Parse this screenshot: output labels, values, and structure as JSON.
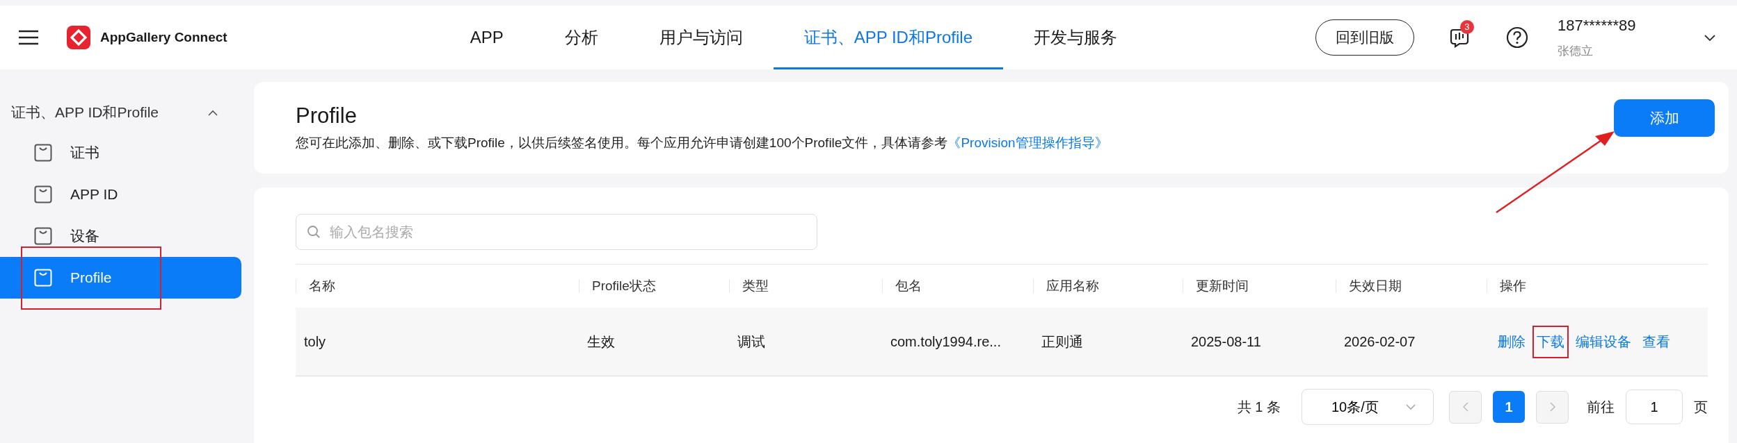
{
  "header": {
    "app_name": "AppGallery Connect",
    "nav": [
      {
        "label": "APP",
        "selected": false
      },
      {
        "label": "分析",
        "selected": false
      },
      {
        "label": "用户与访问",
        "selected": false
      },
      {
        "label": "证书、APP ID和Profile",
        "selected": true
      },
      {
        "label": "开发与服务",
        "selected": false
      }
    ],
    "old_version_button": "回到旧版",
    "notification_count": "3",
    "user": {
      "phone": "187******89",
      "name": "张德立"
    }
  },
  "sidebar": {
    "group": {
      "label": "证书、APP ID和Profile",
      "expanded": true,
      "items": [
        {
          "label": "证书",
          "selected": false,
          "highlighted": false
        },
        {
          "label": "APP ID",
          "selected": false,
          "highlighted": false
        },
        {
          "label": "设备",
          "selected": false,
          "highlighted": false
        },
        {
          "label": "Profile",
          "selected": true,
          "highlighted": true
        }
      ]
    }
  },
  "intro": {
    "title": "Profile",
    "description": "您可在此添加、删除、或下载Profile，以供后续签名使用。每个应用允许申请创建100个Profile文件，具体请参考",
    "link": "《Provision管理操作指导》",
    "add_button": "添加"
  },
  "search": {
    "placeholder": "输入包名搜索"
  },
  "table": {
    "columns": [
      "名称",
      "Profile状态",
      "类型",
      "包名",
      "应用名称",
      "更新时间",
      "失效日期",
      "操作"
    ],
    "rows": [
      {
        "cells": [
          "toly",
          "生效",
          "调试",
          "com.toly1994.re...",
          "正则通",
          "2025-08-11",
          "2026-02-07"
        ],
        "actions": [
          {
            "label": "删除",
            "highlighted": false
          },
          {
            "label": "下载",
            "highlighted": true
          },
          {
            "label": "编辑设备",
            "highlighted": false
          },
          {
            "label": "查看",
            "highlighted": false
          }
        ]
      }
    ]
  },
  "pagination": {
    "total": "共 1 条",
    "page_size": "10条/页",
    "pages": [
      {
        "label": "1",
        "selected": true
      }
    ],
    "goto_label": "前往",
    "goto_value": "1",
    "page_unit": "页"
  }
}
